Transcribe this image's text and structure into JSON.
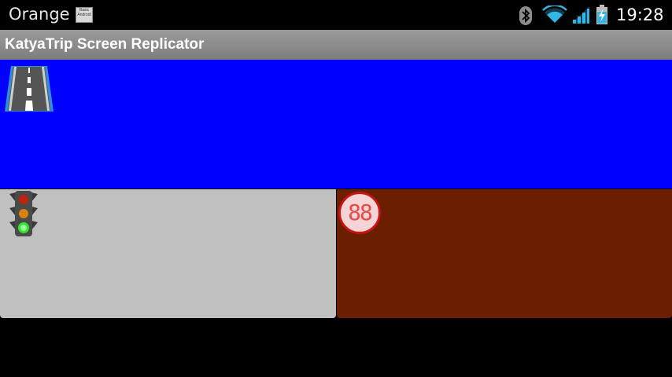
{
  "status_bar": {
    "carrier": "Orange",
    "carrier_app_icon": "basic-android-app-icon",
    "time": "19:28",
    "icons": [
      "bluetooth-icon",
      "wifi-icon",
      "signal-icon",
      "battery-charging-icon"
    ]
  },
  "action_bar": {
    "title": "KatyaTrip Screen Replicator"
  },
  "panels": {
    "road": {
      "icon": "road-icon",
      "color": "#0000ff"
    },
    "traffic": {
      "icon": "traffic-light-icon",
      "color": "#c0c0c0"
    },
    "speed": {
      "icon": "speed-limit-icon",
      "value": "88",
      "color": "#6b1e00"
    }
  }
}
